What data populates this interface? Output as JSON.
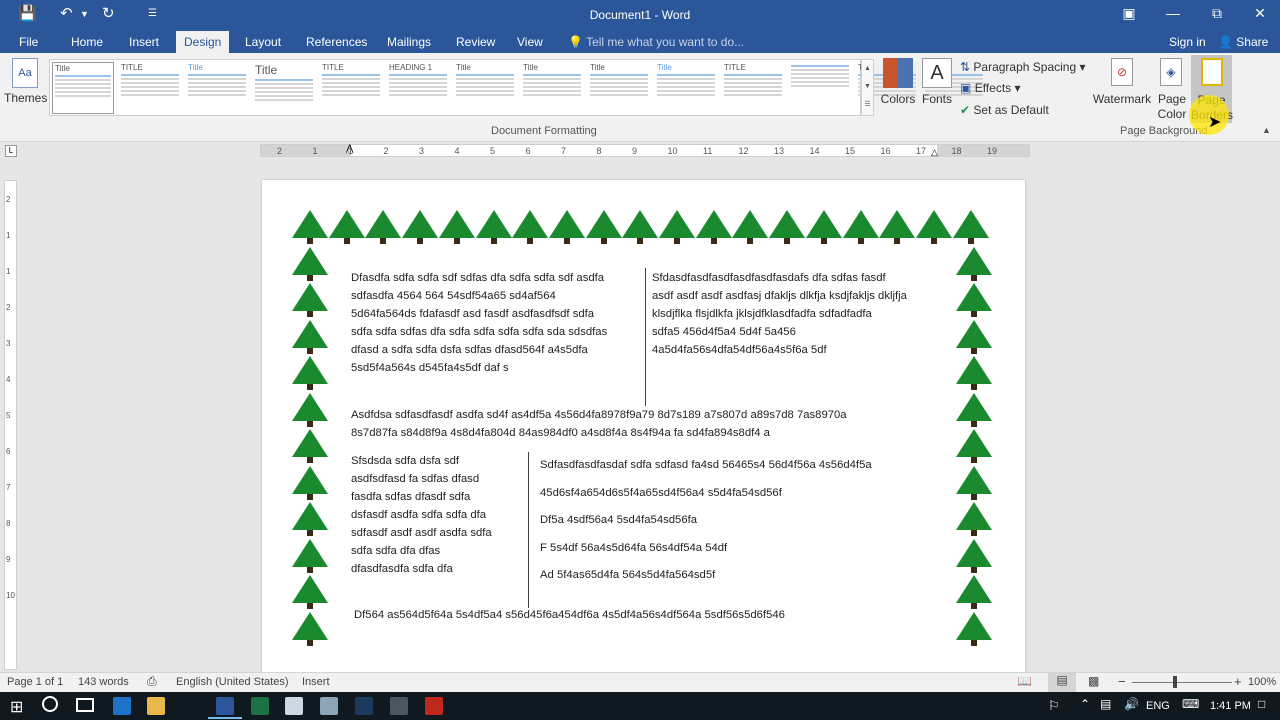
{
  "window": {
    "title": "Document1 - Word"
  },
  "tabs": [
    "File",
    "Home",
    "Insert",
    "Design",
    "Layout",
    "References",
    "Mailings",
    "Review",
    "View"
  ],
  "active_tab": "Design",
  "tell_me": "Tell me what you want to do...",
  "account": {
    "sign_in": "Sign in",
    "share": "Share"
  },
  "ribbon": {
    "themes": "Themes",
    "colors": "Colors",
    "fonts": "Fonts",
    "paragraph_spacing": "Paragraph Spacing",
    "effects": "Effects",
    "set_as_default": "Set as Default",
    "watermark": "Watermark",
    "page_color": "Page Color",
    "page_borders": "Page Borders",
    "group_document_formatting": "Document Formatting",
    "group_page_background": "Page Background",
    "style_thumbs": [
      "Title",
      "TITLE",
      "Title",
      "Title",
      "TITLE",
      "HEADING 1",
      "Title",
      "Title",
      "Title",
      "Title",
      "TITLE",
      "",
      "Title",
      "Title"
    ]
  },
  "ruler_labels": [
    "2",
    "1",
    "1",
    "2",
    "3",
    "4",
    "5",
    "6",
    "7",
    "8",
    "9",
    "10",
    "11",
    "12",
    "13",
    "14",
    "15",
    "16",
    "17",
    "18",
    "19"
  ],
  "vruler_labels": [
    "2",
    "1",
    "1",
    "2",
    "3",
    "4",
    "5",
    "6",
    "7",
    "8",
    "9",
    "10"
  ],
  "document": {
    "col_left_1": [
      "Dfasdfa sdfa sdfa sdf sdfas dfa sdfa sdfa sdf asdfa",
      "sdfasdfa 4564 564 54sdf54a65 sd4af564",
      "5d64fa564ds fdafasdf asd fasdf asdfasdfsdf sdfa",
      "sdfa sdfa sdfas dfa sdfa sdfa sdfa sdfa sda sdsdfas",
      "dfasd a sdfa sdfa dsfa sdfas dfasd564f a4s5dfa",
      "5sd5f4a564s d545fa4s5df daf s"
    ],
    "col_right_1": [
      "Sfdasdfasdfasdfasdfasdfasdafs dfa sdfas fasdf",
      "asdf asdf asdf asdfasj dfakljs dlkfja ksdjfakljs dkljfja",
      "klsdjflka flsjdlkfa jklsjdfklasdfadfa sdfadfadfa",
      "sdfa5 456d4f5a4 5d4f 5a456",
      "4a5d4fa56s4dfa54df56a4s5f6a 5df"
    ],
    "mid_para": [
      "Asdfdsa sdfasdfasdf asdfa sd4f as4df5a 4s56d4fa8978f9a79 8d7s189 a7s807d a89s7d8 7as8970a",
      "8s7d87fa s84d8f9a 4s8d4fa804d 84as984df0 a4sd8f4a 8s4f94a fa sd4fa894s8df4 a"
    ],
    "col_left_2": [
      "Sfsdsda sdfa dsfa sdf",
      "asdfsdfasd fa sdfas dfasd",
      "fasdfa sdfas dfasdf sdfa",
      "dsfasdf asdfa sdfa sdfa dfa",
      "sdfasdf asdf asdf asdfa sdfa",
      "sdfa sdfa dfa dfas",
      "dfasdfasdfa sdfa dfa"
    ],
    "col_right_2": [
      "Sdfasdfasdfasdaf sdfa sdfasd fa4sd 56465s4 56d4f56a 4s56d4f5a",
      "45d6sf4a654d6s5f4a65sd4f56a4 s5d4fa54sd56f",
      "Df5a 4sdf56a4 5sd4fa54sd56fa",
      "F 5s4df 56a4s5d64fa 56s4df54a 54df",
      "Ad 5f4as65d4fa 564s5d4fa564sd5f"
    ],
    "last_para": "Df564 as564d5f64a 5s4df5a4 s56d45f6a454df6a 4s5df4a56s4df564a 5sdf56s5d6f546"
  },
  "status": {
    "page": "Page 1 of 1",
    "words": "143 words",
    "language": "English (United States)",
    "mode": "Insert",
    "zoom": "100%"
  },
  "taskbar": {
    "lang": "ENG",
    "time": "1:41 PM"
  },
  "colors": {
    "word_blue": "#2b579a",
    "tree_green": "#1b8a2f"
  }
}
